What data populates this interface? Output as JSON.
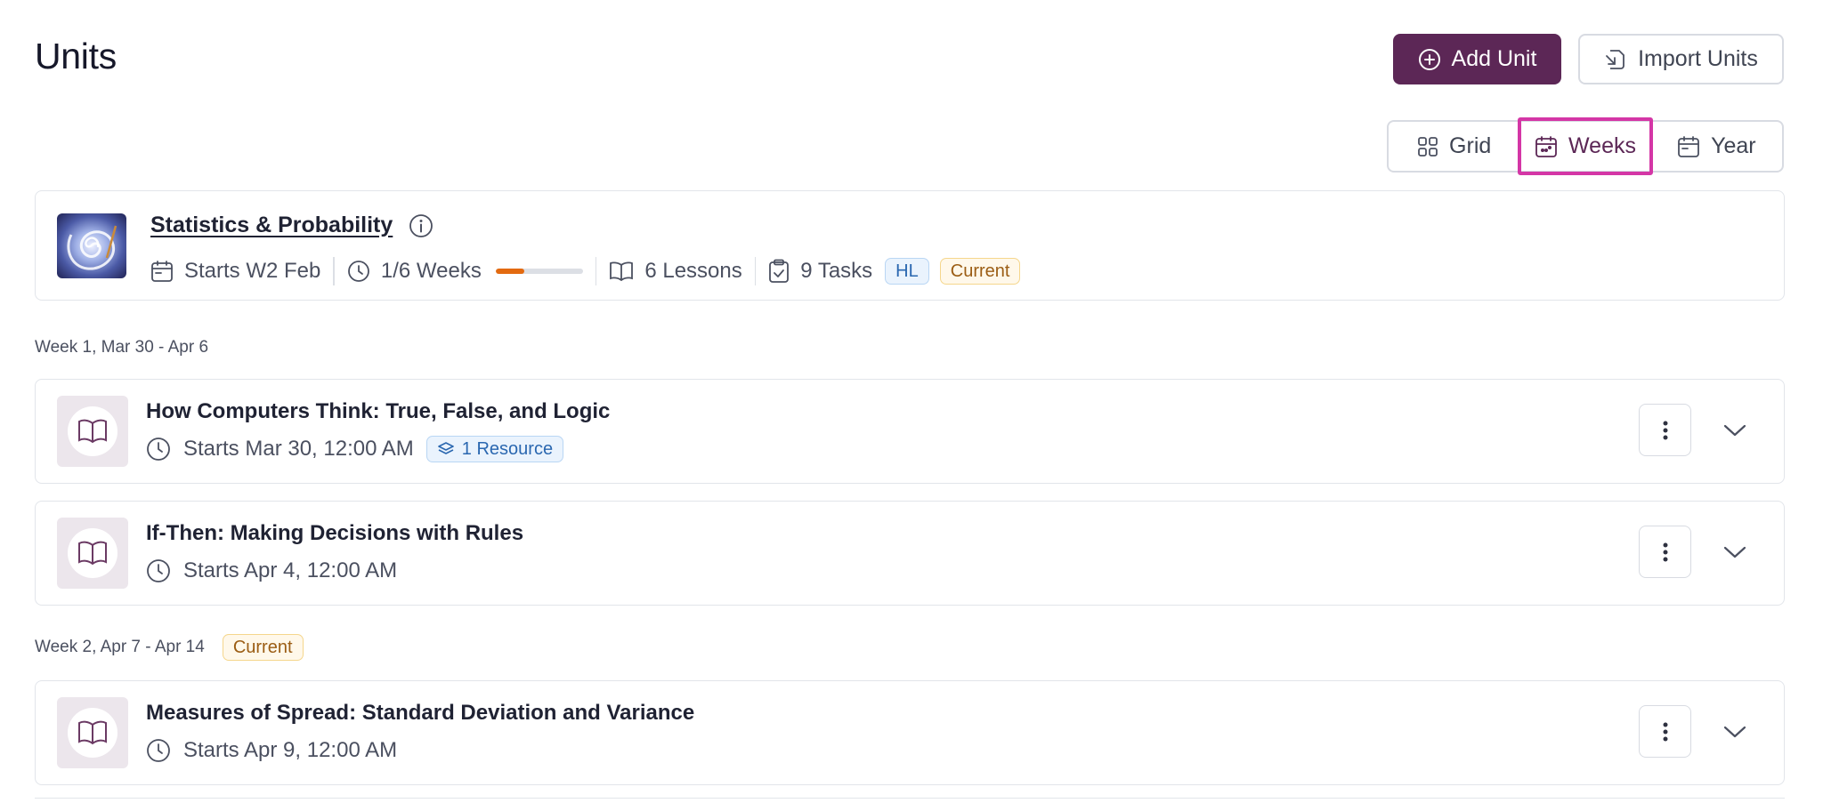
{
  "page": {
    "title": "Units"
  },
  "toolbar": {
    "add_unit_label": "Add Unit",
    "import_units_label": "Import Units"
  },
  "view_switch": {
    "options": [
      {
        "label": "Grid",
        "icon": "grid-icon",
        "selected": false
      },
      {
        "label": "Weeks",
        "icon": "calendar-weeks-icon",
        "selected": true
      },
      {
        "label": "Year",
        "icon": "calendar-year-icon",
        "selected": false
      }
    ]
  },
  "unit": {
    "title": "Statistics & Probability",
    "starts": "Starts W2 Feb",
    "weeks": "1/6 Weeks",
    "progress_fraction": 0.33,
    "lessons": "6 Lessons",
    "tasks": "9 Tasks",
    "level_badge": "HL",
    "status_badge": "Current"
  },
  "weeks": [
    {
      "label": "Week 1, Mar 30 - Apr 6",
      "badge": "",
      "lessons": [
        {
          "title": "How Computers Think: True, False, and Logic",
          "starts": "Starts Mar 30, 12:00 AM",
          "resource": "1 Resource"
        },
        {
          "title": "If-Then: Making Decisions with Rules",
          "starts": "Starts Apr 4, 12:00 AM",
          "resource": ""
        }
      ]
    },
    {
      "label": "Week 2, Apr 7 - Apr 14",
      "badge": "Current",
      "lessons": [
        {
          "title": "Measures of Spread: Standard Deviation and Variance",
          "starts": "Starts Apr 9, 12:00 AM",
          "resource": ""
        }
      ]
    }
  ],
  "colors": {
    "primary": "#5c2756",
    "accent_highlight": "#d436a6",
    "progress": "#e36a10",
    "badge_blue": "#2a67b0",
    "badge_amber": "#9b5d14"
  }
}
